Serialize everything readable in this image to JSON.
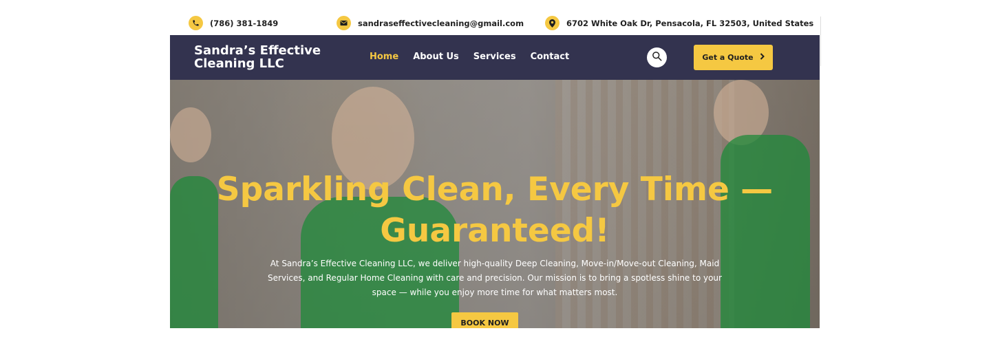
{
  "topbar": {
    "phone": "(786) 381-1849",
    "email": "sandraseffectivecleaning@gmail.com",
    "address": "6702 White Oak Dr, Pensacola, FL 32503, United States",
    "phone_icon": "phone-icon",
    "email_icon": "envelope-icon",
    "address_icon": "map-pin-icon"
  },
  "header": {
    "logo_line1": "Sandra’s Effective",
    "logo_line2": "Cleaning LLC",
    "nav": [
      {
        "label": "Home",
        "active": true
      },
      {
        "label": "About Us",
        "active": false
      },
      {
        "label": "Services",
        "active": false
      },
      {
        "label": "Contact",
        "active": false
      }
    ],
    "search_icon": "search-icon",
    "quote_label": "Get a Quote",
    "quote_icon": "chevron-right-icon"
  },
  "hero": {
    "title_line1": "Sparkling Clean, Every Time —",
    "title_line2": "Guaranteed!",
    "text_line1": "At Sandra’s Effective Cleaning LLC, we deliver high-quality Deep Cleaning, Move-in/Move-out Cleaning, Maid",
    "text_line2": "Services, and Regular Home Cleaning with care and precision. Our mission is to bring a spotless shine to your",
    "text_line3": "space — while you enjoy more time for what matters most.",
    "cta_label": "BOOK NOW"
  },
  "colors": {
    "accent": "#f5c842",
    "nav_bg": "#33334f",
    "text_dark": "#1f1f1f"
  }
}
